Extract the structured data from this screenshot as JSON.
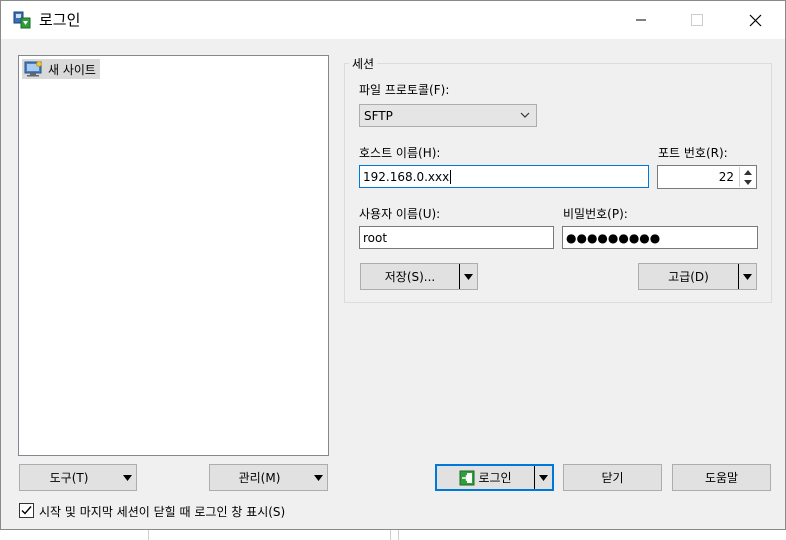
{
  "window": {
    "title": "로그인",
    "minimize_icon": "minimize-icon",
    "maximize_icon": "maximize-icon",
    "close_icon": "close-icon"
  },
  "site_tree": {
    "items": [
      {
        "label": "새 사이트",
        "icon": "computer-monitor-icon",
        "selected": true
      }
    ]
  },
  "session": {
    "group_title": "세션",
    "protocol_label": "파일 프로토콜(F):",
    "protocol_value": "SFTP",
    "host_label": "호스트 이름(H):",
    "host_value": "192.168.0.xxx",
    "port_label": "포트 번호(R):",
    "port_value": "22",
    "user_label": "사용자 이름(U):",
    "user_value": "root",
    "password_label": "비밀번호(P):",
    "password_value": "●●●●●●●●●",
    "save_button": "저장(S)...",
    "advanced_button": "고급(D)"
  },
  "bottom": {
    "tools_button": "도구(T)",
    "manage_button": "관리(M)",
    "login_button": "로그인",
    "close_button": "닫기",
    "help_button": "도움말",
    "checkbox_label": "시작 및 마지막 세션이 닫힐 때 로그인 창 표시(S)",
    "checkbox_checked": true
  },
  "colors": {
    "accent": "#0078d7",
    "dialog_bg": "#f0f0f0"
  }
}
